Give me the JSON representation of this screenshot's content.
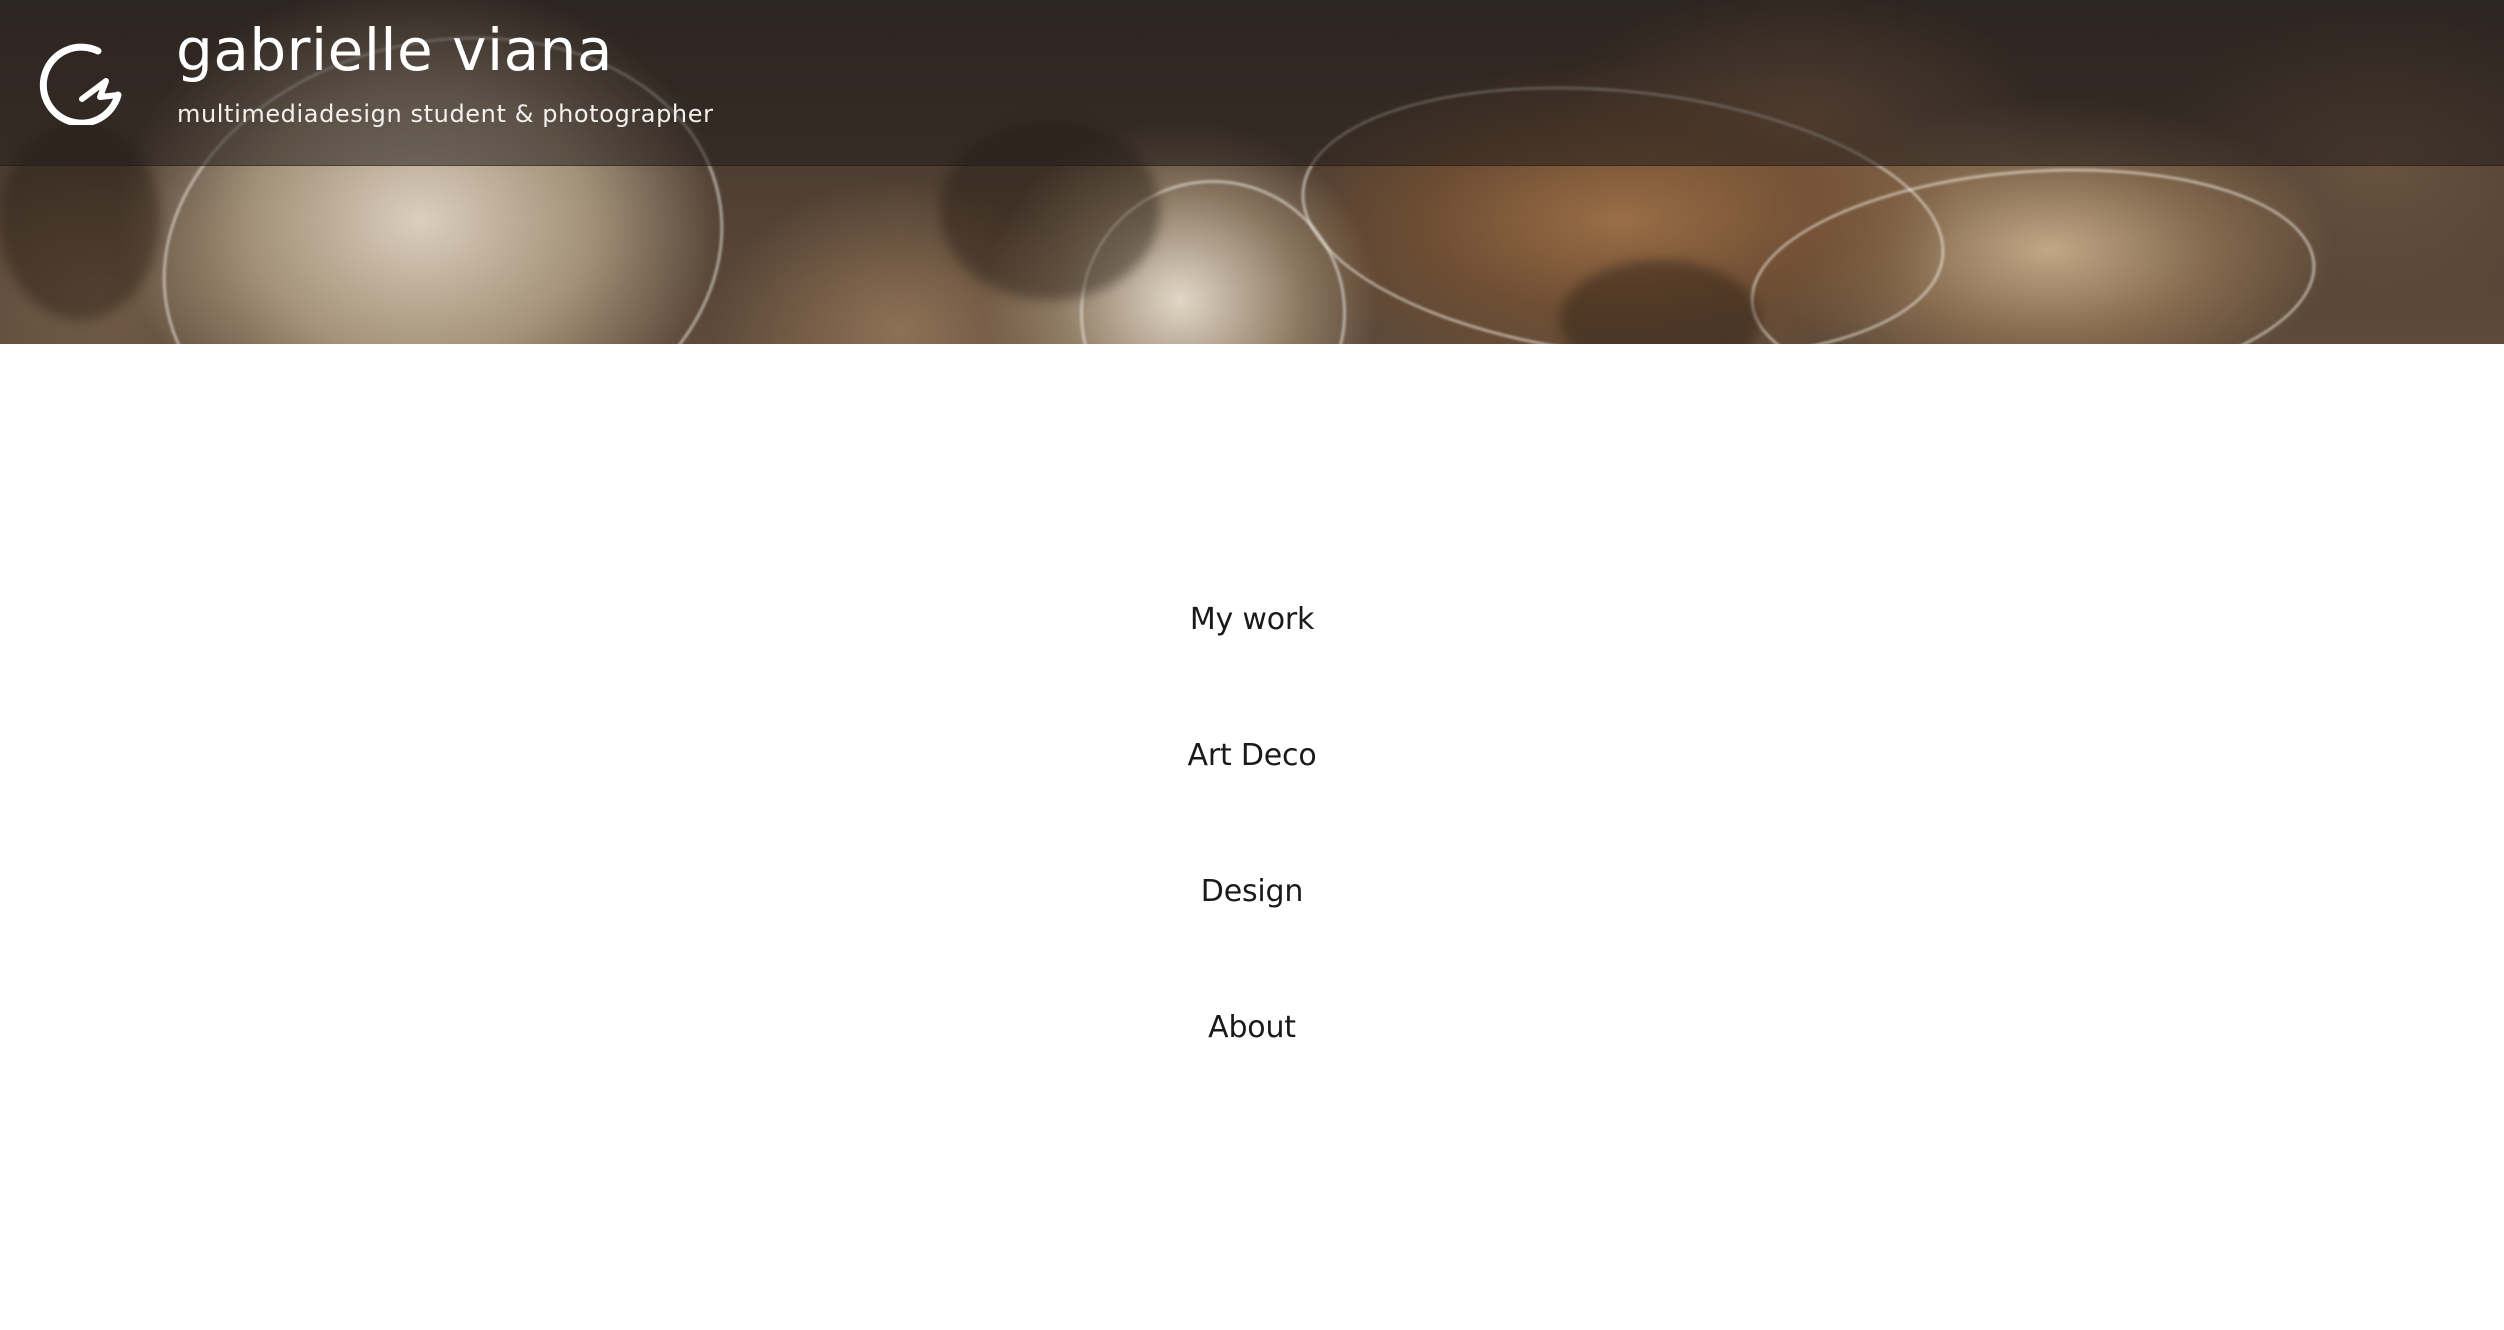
{
  "site": {
    "title": "gabrielle viana",
    "tagline": "multimediadesign student & photographer",
    "logo_icon": "gv-monogram-logo"
  },
  "nav": {
    "items": [
      {
        "label": "My work"
      },
      {
        "label": "Art Deco"
      },
      {
        "label": "Design"
      },
      {
        "label": "About"
      }
    ]
  },
  "colors": {
    "header_overlay": "#231e1b",
    "text_light": "#ffffff",
    "nav_text": "#1a1a1a",
    "background": "#ffffff"
  }
}
